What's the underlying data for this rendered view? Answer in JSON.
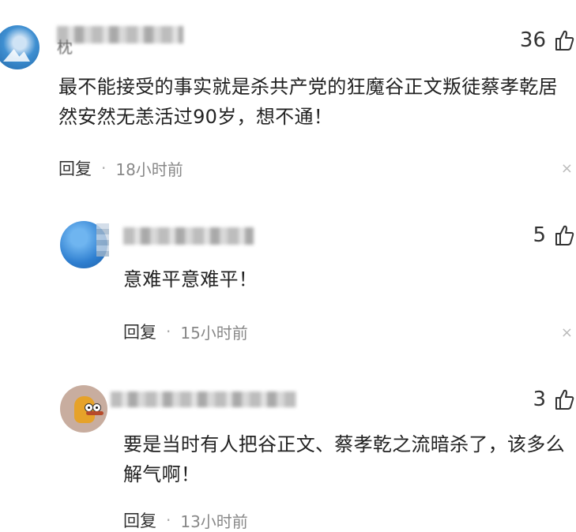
{
  "comments": [
    {
      "text": "最不能接受的事实就是杀共产党的狂魔谷正文叛徒蔡孝乾居然安然无恙活过90岁，想不通！",
      "likes": "36",
      "reply_label": "回复",
      "separator": "·",
      "time": "18小时前",
      "name_glyph": "枕",
      "close_glyph": "×"
    },
    {
      "text": "意难平意难平！",
      "likes": "5",
      "reply_label": "回复",
      "separator": "·",
      "time": "15小时前",
      "close_glyph": "×"
    },
    {
      "text": "要是当时有人把谷正文、蔡孝乾之流暗杀了，该多么解气啊！",
      "likes": "3",
      "reply_label": "回复",
      "separator": "·",
      "time": "13小时前"
    }
  ],
  "icons": {
    "like": "thumbs-up-icon",
    "close": "close-icon"
  }
}
